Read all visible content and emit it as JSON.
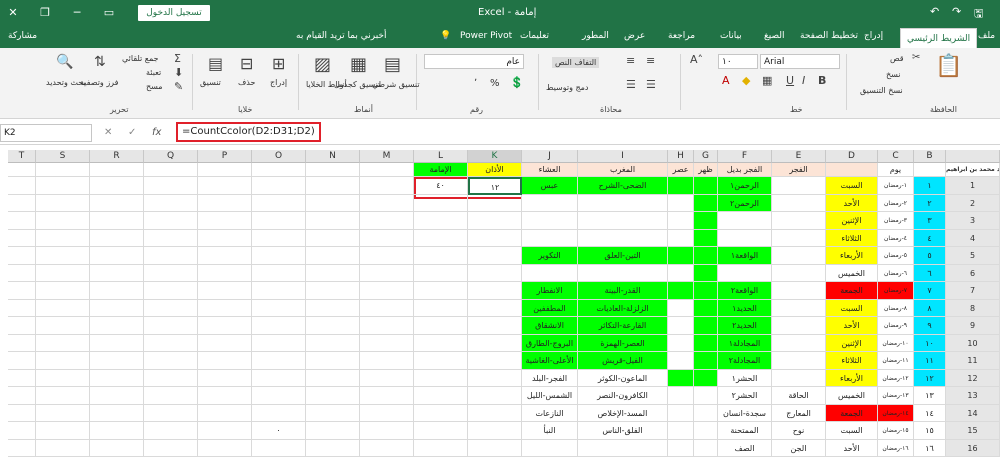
{
  "titlebar": {
    "app_title": "Excel - إمامة",
    "signin": "تسجيل الدخول",
    "minimize": "─",
    "restore": "❐",
    "close": "✕",
    "ribbon_display": "▭"
  },
  "tabs": [
    "ملف",
    "الشريط الرئيسي",
    "إدراج",
    "تخطيط الصفحة",
    "الصيغ",
    "بيانات",
    "مراجعة",
    "عرض",
    "المطور",
    "تعليمات",
    "Power Pivot",
    "أخبرني بما تريد القيام به",
    "مشاركة"
  ],
  "ribbon": {
    "clipboard": {
      "cut": "قص",
      "copy": "نسخ",
      "format_painter": "نسخ التنسيق",
      "label": "الحافظة"
    },
    "font": {
      "name": "Arial",
      "size": "١٠",
      "label": "خط"
    },
    "alignment": {
      "wrap": "التفاف النص",
      "merge": "دمج وتوسيط",
      "label": "محاذاة"
    },
    "number": {
      "format": "عام",
      "percent": "%",
      "comma": "٬",
      "label": "رقم"
    },
    "styles": {
      "conditional": "تنسيق شرطي",
      "as_table": "تنسيق كجدول",
      "cell_styles": "أنماط الخلايا",
      "label": "أنماط"
    },
    "cells": {
      "insert": "إدراج",
      "delete": "حذف",
      "format": "تنسيق",
      "label": "خلايا"
    },
    "editing": {
      "autosum": "جمع تلقائي",
      "fill": "تعبئة",
      "clear": "مسح",
      "sort": "فرز وتصفية",
      "find": "بحث وتحديد",
      "label": "تحرير"
    }
  },
  "formula_bar": {
    "name_box": "K2",
    "formula": "=CountCcolor(D2:D31;D2)",
    "fx": "fx",
    "cancel": "✕",
    "enter": "✓"
  },
  "colors": {
    "green": "#00ff00",
    "yellow": "#ffff00",
    "cyan": "#00e5ff",
    "red": "#ff0000",
    "peach": "#fce4d6",
    "brand": "#217346"
  },
  "columns": [
    "A",
    "B",
    "C",
    "D",
    "E",
    "F",
    "G",
    "H",
    "I",
    "J",
    "K",
    "L",
    "M",
    "N",
    "O",
    "P",
    "Q",
    "R",
    "S",
    "T"
  ],
  "sheet": {
    "A1": "مسجد محمد بن ابراهيم",
    "C1": "يوم",
    "D1": "",
    "E1": "الفجر",
    "F1": "الفجر بديل",
    "G1": "ظهر",
    "H1": "عصر",
    "I1": "المغرب",
    "J1": "العشاء",
    "K1": "الأذان",
    "L1": "الإمامة",
    "K2": "١٢",
    "L2": "٤٠",
    "O18": "٠",
    "B": [
      "١",
      "٢",
      "٣",
      "٤",
      "٥",
      "٦",
      "٧",
      "٨",
      "٩",
      "١٠",
      "١١",
      "١٢",
      "١٣",
      "١٤",
      "١٥",
      "١٦"
    ],
    "C": [
      "١-رمضان",
      "٢-رمضان",
      "٣-رمضان",
      "٤-رمضان",
      "٥-رمضان",
      "٦-رمضان",
      "٧-رمضان",
      "٨-رمضان",
      "٩-رمضان",
      "١٠-رمضان",
      "١١-رمضان",
      "١٢-رمضان",
      "١٣-رمضان",
      "١٤-رمضان",
      "١٥-رمضان",
      "١٦-رمضان"
    ],
    "D": [
      "السبت",
      "الأحد",
      "الإثنين",
      "الثلاثاء",
      "الأربعاء",
      "الخميس",
      "الجمعة",
      "السبت",
      "الأحد",
      "الإثنين",
      "الثلاثاء",
      "الأربعاء",
      "الخميس",
      "الجمعة",
      "السبت",
      "الأحد"
    ],
    "E": [
      "",
      "",
      "",
      "",
      "",
      "",
      "",
      "",
      "",
      "",
      "",
      "",
      "الحاقة",
      "المعارج",
      "نوح",
      "الجن"
    ],
    "F": [
      "الرحمن١",
      "الرحمن٢",
      "",
      "",
      "الواقعة١",
      "",
      "الواقعة٢",
      "الحديد١",
      "الحديد٢",
      "المجادلة١",
      "المجادلة٢",
      "الحشر١",
      "الحشر٢",
      "سجدة-انسان",
      "الممتحنة",
      "الصف"
    ],
    "I": [
      "الضحى-الشرح",
      "",
      "",
      "",
      "التين-العلق",
      "",
      "القدر-البينة",
      "الزلزلة-العاديات",
      "القارعة-التكاثر",
      "العصر-الهمزة",
      "الفيل-قريش",
      "الماعون-الكوثر",
      "الكافرون-النصر",
      "المسد-الإخلاص",
      "الفلق-الناس",
      ""
    ],
    "J": [
      "عبس",
      "",
      "",
      "",
      "التكوير",
      "",
      "الانفطار",
      "المطففين",
      "الانشقاق",
      "البروج-الطارق",
      "الأعلى-الغاشية",
      "الفجر-البلد",
      "الشمس-الليل",
      "النازعات",
      "النبأ",
      ""
    ]
  }
}
